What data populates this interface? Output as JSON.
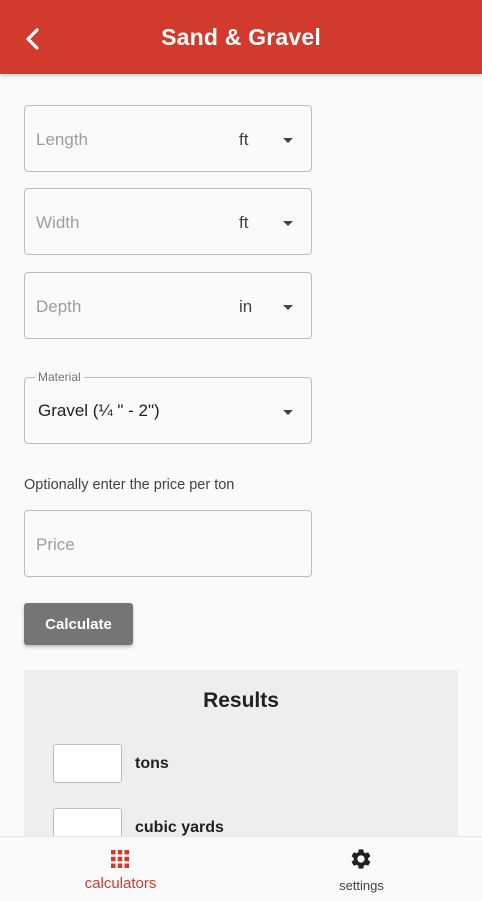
{
  "app_bar": {
    "title": "Sand & Gravel",
    "back_icon": "arrow-back-icon",
    "background_color": "#d23a2e"
  },
  "form": {
    "length": {
      "placeholder": "Length",
      "unit": "ft"
    },
    "width": {
      "placeholder": "Width",
      "unit": "ft"
    },
    "depth": {
      "placeholder": "Depth",
      "unit": "in"
    },
    "material": {
      "label": "Material",
      "value": "Gravel (¼ \" - 2\")"
    },
    "price_helper": "Optionally enter the price per ton",
    "price": {
      "placeholder": "Price"
    },
    "calculate_label": "Calculate"
  },
  "results": {
    "title": "Results",
    "items": [
      {
        "label": "tons",
        "value": ""
      },
      {
        "label": "cubic yards",
        "value": ""
      }
    ]
  },
  "bottom_nav": {
    "items": [
      {
        "label": "calculators",
        "icon": "grid-icon",
        "active": true
      },
      {
        "label": "settings",
        "icon": "gear-icon",
        "active": false
      }
    ],
    "active_color": "#d23a2e"
  }
}
